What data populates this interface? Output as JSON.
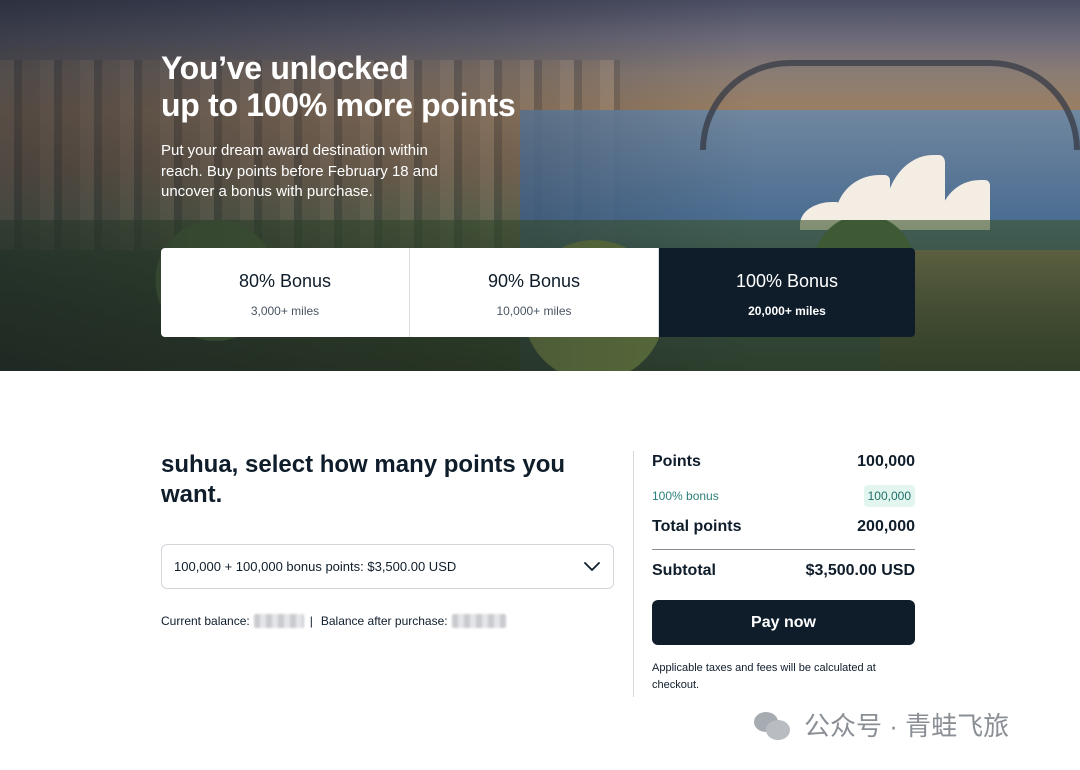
{
  "hero": {
    "title_line1": "You’ve unlocked",
    "title_line2": "up to 100% more points",
    "subtitle": "Put your dream award destination within reach. Buy points before February 18 and uncover a bonus with purchase.",
    "tiers": [
      {
        "label": "80% Bonus",
        "sub": "3,000+ miles",
        "selected": false
      },
      {
        "label": "90% Bonus",
        "sub": "10,000+ miles",
        "selected": false
      },
      {
        "label": "100% Bonus",
        "sub": "20,000+ miles",
        "selected": true
      }
    ]
  },
  "purchase": {
    "heading": "suhua, select how many points you want.",
    "select_value": "100,000 + 100,000 bonus points: $3,500.00 USD",
    "current_balance_label": "Current balance:",
    "separator": "|",
    "balance_after_label": "Balance after purchase:"
  },
  "summary": {
    "points_label": "Points",
    "points_value": "100,000",
    "bonus_label": "100% bonus",
    "bonus_value": "100,000",
    "total_label": "Total points",
    "total_value": "200,000",
    "subtotal_label": "Subtotal",
    "subtotal_value": "$3,500.00 USD",
    "pay_label": "Pay now",
    "note": "Applicable taxes and fees will be calculated at checkout."
  },
  "watermark": {
    "text": "公众号 · 青蛙飞旅"
  },
  "colors": {
    "navy": "#0f1d2b",
    "bonus_green": "#2a7f7a",
    "bonus_badge_bg": "#e3f5ef"
  }
}
